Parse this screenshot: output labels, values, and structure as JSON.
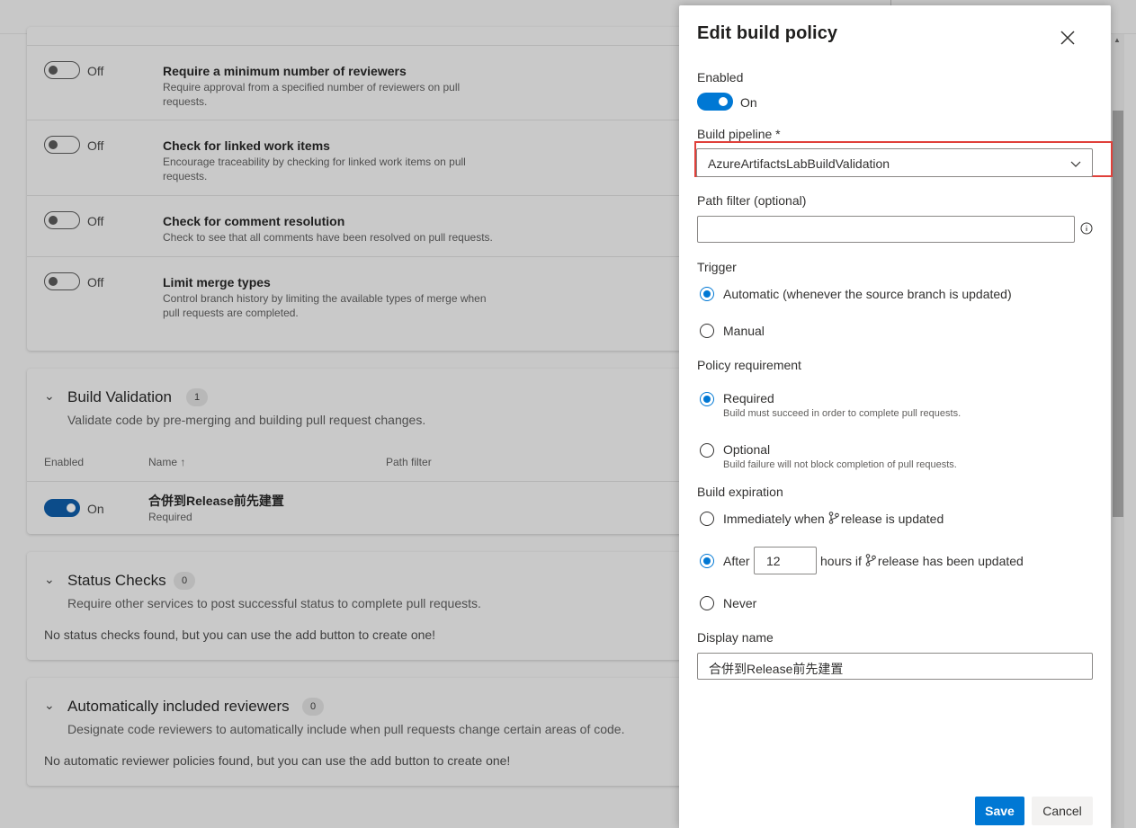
{
  "background": {
    "policies": [
      {
        "toggle": "Off",
        "title": "Require a minimum number of reviewers",
        "desc": "Require approval from a specified number of reviewers on pull requests."
      },
      {
        "toggle": "Off",
        "title": "Check for linked work items",
        "desc": "Encourage traceability by checking for linked work items on pull requests."
      },
      {
        "toggle": "Off",
        "title": "Check for comment resolution",
        "desc": "Check to see that all comments have been resolved on pull requests."
      },
      {
        "toggle": "Off",
        "title": "Limit merge types",
        "desc": "Control branch history by limiting the available types of merge when pull requests are completed."
      }
    ],
    "build_validation": {
      "title": "Build Validation",
      "count": "1",
      "desc": "Validate code by pre-merging and building pull request changes.",
      "columns": {
        "enabled": "Enabled",
        "name": "Name ↑",
        "path": "Path filter"
      },
      "row": {
        "toggle": "On",
        "name": "合併到Release前先建置",
        "status": "Required"
      }
    },
    "status_checks": {
      "title": "Status Checks",
      "count": "0",
      "desc": "Require other services to post successful status to complete pull requests.",
      "empty": "No status checks found, but you can use the add button to create one!"
    },
    "auto_reviewers": {
      "title": "Automatically included reviewers",
      "count": "0",
      "desc": "Designate code reviewers to automatically include when pull requests change certain areas of code.",
      "empty": "No automatic reviewer policies found, but you can use the add button to create one!"
    }
  },
  "panel": {
    "title": "Edit build policy",
    "enabled_label": "Enabled",
    "enabled_state": "On",
    "pipeline_label": "Build pipeline *",
    "pipeline_value": "AzureArtifactsLabBuildValidation",
    "path_label": "Path filter (optional)",
    "path_value": "",
    "trigger_label": "Trigger",
    "trigger_auto": "Automatic (whenever the source branch is updated)",
    "trigger_manual": "Manual",
    "requirement_label": "Policy requirement",
    "req_required": "Required",
    "req_required_sub": "Build must succeed in order to complete pull requests.",
    "req_optional": "Optional",
    "req_optional_sub": "Build failure will not block completion of pull requests.",
    "expiration_label": "Build expiration",
    "exp_immediate_prefix": "Immediately when",
    "exp_immediate_suffix": "release is updated",
    "exp_after": "After",
    "exp_hours": "12",
    "exp_after_mid": "hours if",
    "exp_after_suffix": "release has been updated",
    "exp_never": "Never",
    "display_label": "Display name",
    "display_value": "合併到Release前先建置",
    "save": "Save",
    "cancel": "Cancel"
  },
  "colors": {
    "accent": "#0078d4",
    "highlight": "#e0403a"
  }
}
